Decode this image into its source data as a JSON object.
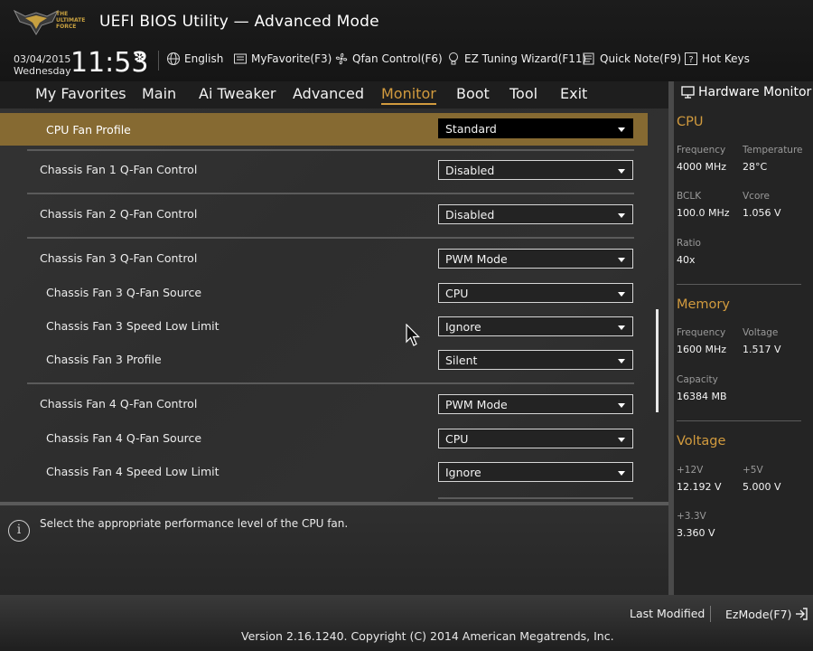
{
  "header": {
    "logo_text": "THE ULTIMATE FORCE",
    "title": "UEFI BIOS Utility — Advanced Mode",
    "date": "03/04/2015",
    "day": "Wednesday",
    "time": "11:53",
    "tools": [
      {
        "label": "English",
        "icon": "globe-icon"
      },
      {
        "label": "MyFavorite(F3)",
        "icon": "favorite-icon"
      },
      {
        "label": "Qfan Control(F6)",
        "icon": "fan-icon"
      },
      {
        "label": "EZ Tuning Wizard(F11)",
        "icon": "lightbulb-icon"
      },
      {
        "label": "Quick Note(F9)",
        "icon": "note-icon"
      },
      {
        "label": "Hot Keys",
        "icon": "help-icon"
      }
    ]
  },
  "nav": {
    "items": [
      "My Favorites",
      "Main",
      "Ai Tweaker",
      "Advanced",
      "Monitor",
      "Boot",
      "Tool",
      "Exit"
    ],
    "active": "Monitor"
  },
  "settings": [
    {
      "label": "CPU Fan Profile",
      "value": "Standard"
    },
    {
      "label": "Chassis Fan 1 Q-Fan Control",
      "value": "Disabled"
    },
    {
      "label": "Chassis Fan 2 Q-Fan Control",
      "value": "Disabled"
    },
    {
      "label": "Chassis Fan 3 Q-Fan Control",
      "value": "PWM Mode"
    },
    {
      "label": "Chassis Fan 3 Q-Fan Source",
      "value": "CPU"
    },
    {
      "label": "Chassis Fan 3 Speed Low Limit",
      "value": "Ignore"
    },
    {
      "label": "Chassis Fan 3 Profile",
      "value": "Silent"
    },
    {
      "label": "Chassis Fan 4 Q-Fan Control",
      "value": "PWM Mode"
    },
    {
      "label": "Chassis Fan 4 Q-Fan Source",
      "value": "CPU"
    },
    {
      "label": "Chassis Fan 4 Speed Low Limit",
      "value": "Ignore"
    }
  ],
  "help": {
    "text": "Select the appropriate performance level of the CPU fan."
  },
  "hardware_monitor": {
    "title": "Hardware Monitor",
    "cpu": {
      "heading": "CPU",
      "frequency_label": "Frequency",
      "frequency": "4000 MHz",
      "temperature_label": "Temperature",
      "temperature": "28°C",
      "bclk_label": "BCLK",
      "bclk": "100.0 MHz",
      "vcore_label": "Vcore",
      "vcore": "1.056 V",
      "ratio_label": "Ratio",
      "ratio": "40x"
    },
    "memory": {
      "heading": "Memory",
      "frequency_label": "Frequency",
      "frequency": "1600 MHz",
      "voltage_label": "Voltage",
      "voltage": "1.517 V",
      "capacity_label": "Capacity",
      "capacity": "16384 MB"
    },
    "voltage": {
      "heading": "Voltage",
      "v12_label": "+12V",
      "v12": "12.192 V",
      "v5_label": "+5V",
      "v5": "5.000 V",
      "v33_label": "+3.3V",
      "v33": "3.360 V"
    }
  },
  "footer": {
    "last_modified": "Last Modified",
    "ezmode": "EzMode(F7)",
    "version": "Version 2.16.1240. Copyright (C) 2014 American Megatrends, Inc."
  },
  "colors": {
    "accent": "#d29b3e",
    "highlight_row": "#866a32"
  }
}
